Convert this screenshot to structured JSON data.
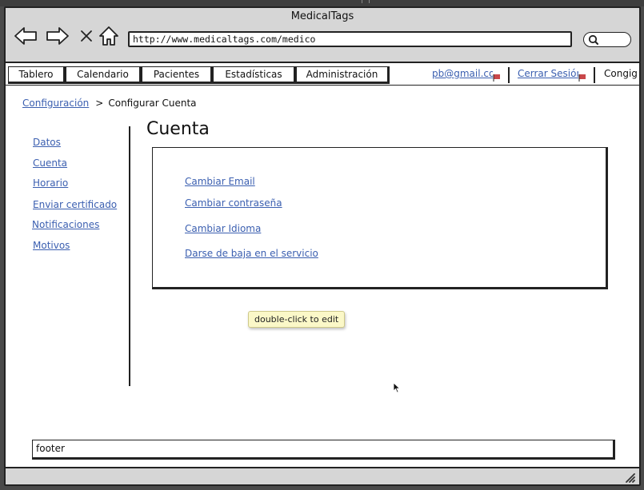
{
  "app": {
    "title": "MedicalTags"
  },
  "browser": {
    "url": "http://www.medicaltags.com/medico",
    "back_icon": "arrow-left-icon",
    "forward_icon": "arrow-right-icon",
    "stop_icon": "close-icon",
    "home_icon": "home-icon",
    "search_icon": "search-icon"
  },
  "tabs": [
    {
      "label": "Tablero"
    },
    {
      "label": "Calendario"
    },
    {
      "label": "Pacientes"
    },
    {
      "label": "Estadísticas"
    },
    {
      "label": "Administración"
    }
  ],
  "topbar": {
    "email": "pb@gmail.con",
    "logout": "Cerrar Sesión",
    "config": "Congig"
  },
  "breadcrumb": {
    "parent": "Configuración",
    "separator": ">",
    "current": "Configurar Cuenta"
  },
  "sidebar": {
    "items": [
      {
        "label": "Datos"
      },
      {
        "label": "Cuenta"
      },
      {
        "label": "Horario"
      },
      {
        "label": "Enviar certificado"
      },
      {
        "label": "Notificaciones"
      },
      {
        "label": "Motivos"
      }
    ]
  },
  "main": {
    "title": "Cuenta",
    "links": [
      {
        "label": "Cambiar Email"
      },
      {
        "label": "Cambiar contraseña"
      },
      {
        "label": "Cambiar Idioma"
      },
      {
        "label": "Darse de baja en el servicio"
      }
    ]
  },
  "tooltip": {
    "text": "double-click to edit"
  },
  "footer": {
    "text": "footer"
  },
  "colors": {
    "link": "#3b5fb0",
    "chrome": "#d6d6d6",
    "tooltip_bg": "#fbf8c8",
    "flag": "#c9474a"
  }
}
